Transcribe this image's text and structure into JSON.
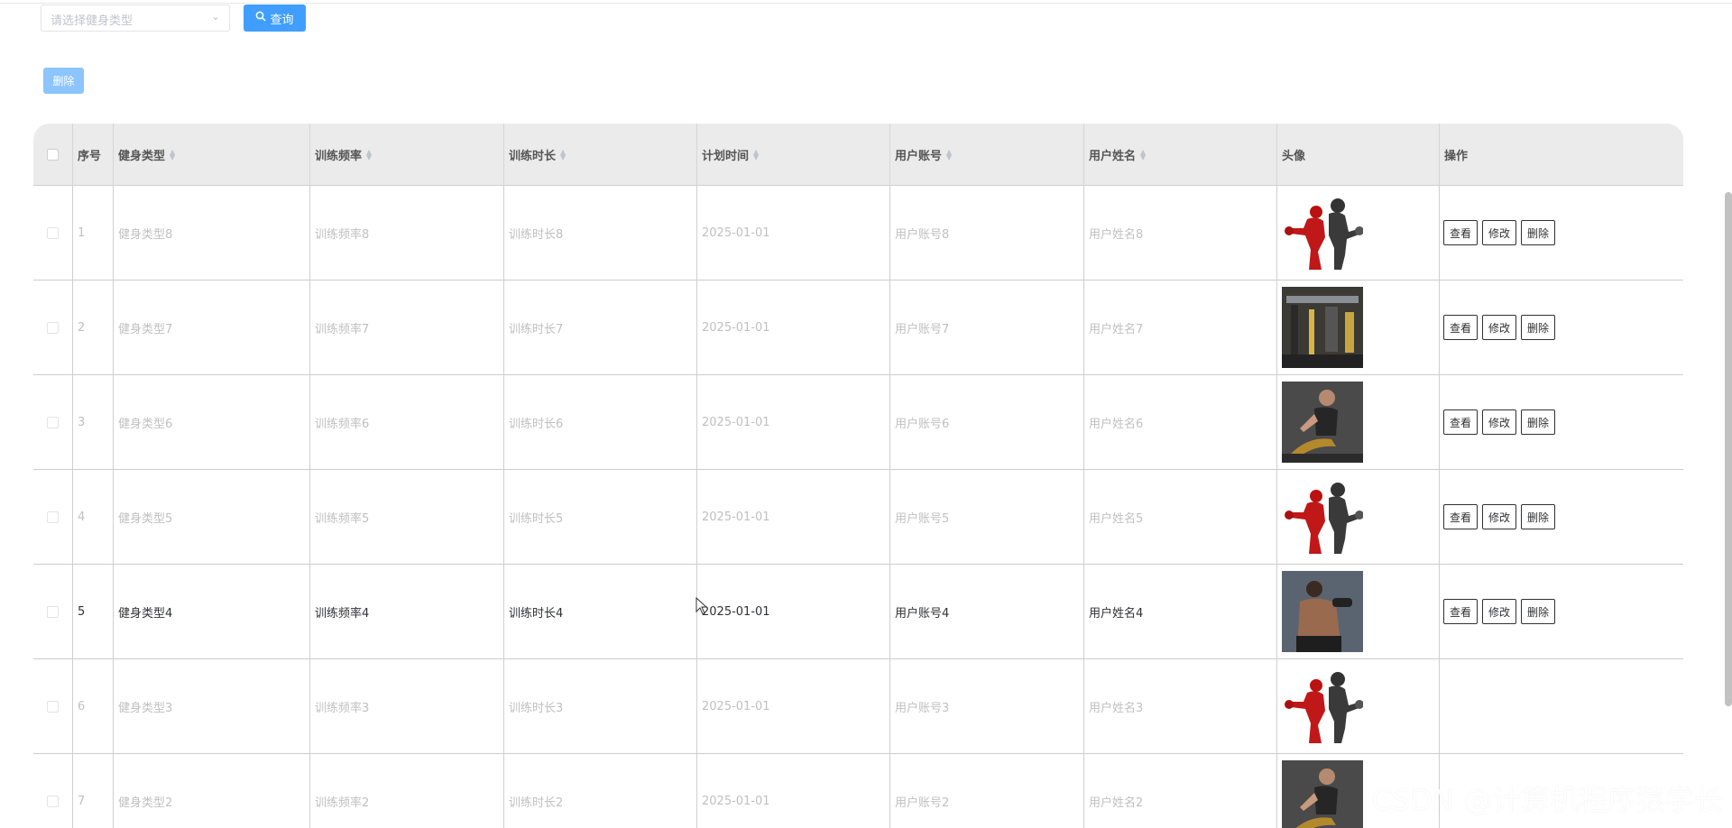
{
  "search": {
    "placeholder": "请选择健身类型",
    "query_label": "查询"
  },
  "toolbar": {
    "delete_label": "删除"
  },
  "table": {
    "headers": [
      "序号",
      "健身类型",
      "训练频率",
      "训练时长",
      "计划时间",
      "用户账号",
      "用户姓名",
      "头像",
      "操作"
    ],
    "rows": [
      {
        "no": "1",
        "type": "健身类型8",
        "freq": "训练频率8",
        "duration": "训练时长8",
        "date": "2025-01-01",
        "account": "用户账号8",
        "name": "用户姓名8",
        "avatar": "fitness-silhouette-image",
        "show_ops": true
      },
      {
        "no": "2",
        "type": "健身类型7",
        "freq": "训练频率7",
        "duration": "训练时长7",
        "date": "2025-01-01",
        "account": "用户账号7",
        "name": "用户姓名7",
        "avatar": "gym-photo-image",
        "show_ops": true
      },
      {
        "no": "3",
        "type": "健身类型6",
        "freq": "训练频率6",
        "duration": "训练时长6",
        "date": "2025-01-01",
        "account": "用户账号6",
        "name": "用户姓名6",
        "avatar": "woman-exercise-photo",
        "show_ops": true
      },
      {
        "no": "4",
        "type": "健身类型5",
        "freq": "训练频率5",
        "duration": "训练时长5",
        "date": "2025-01-01",
        "account": "用户账号5",
        "name": "用户姓名5",
        "avatar": "fitness-silhouette-image",
        "show_ops": true
      },
      {
        "no": "5",
        "type": "健身类型4",
        "freq": "训练频率4",
        "duration": "训练时长4",
        "date": "2025-01-01",
        "account": "用户账号4",
        "name": "用户姓名4",
        "avatar": "man-dumbbell-photo",
        "show_ops": true
      },
      {
        "no": "6",
        "type": "健身类型3",
        "freq": "训练频率3",
        "duration": "训练时长3",
        "date": "2025-01-01",
        "account": "用户账号3",
        "name": "用户姓名3",
        "avatar": "fitness-silhouette-image",
        "show_ops": false
      },
      {
        "no": "7",
        "type": "健身类型2",
        "freq": "训练频率2",
        "duration": "训练时长2",
        "date": "2025-01-01",
        "account": "用户账号2",
        "name": "用户姓名2",
        "avatar": "woman-exercise-photo",
        "show_ops": false
      }
    ],
    "active_row_index": 4
  },
  "row_actions": {
    "view": "查看",
    "edit": "修改",
    "delete": "删除"
  },
  "watermark": "CSDN @计算机程序猿学长",
  "colors": {
    "primary": "#409eff",
    "primary_light": "#8cc5ff",
    "header_bg": "#ebebeb"
  }
}
